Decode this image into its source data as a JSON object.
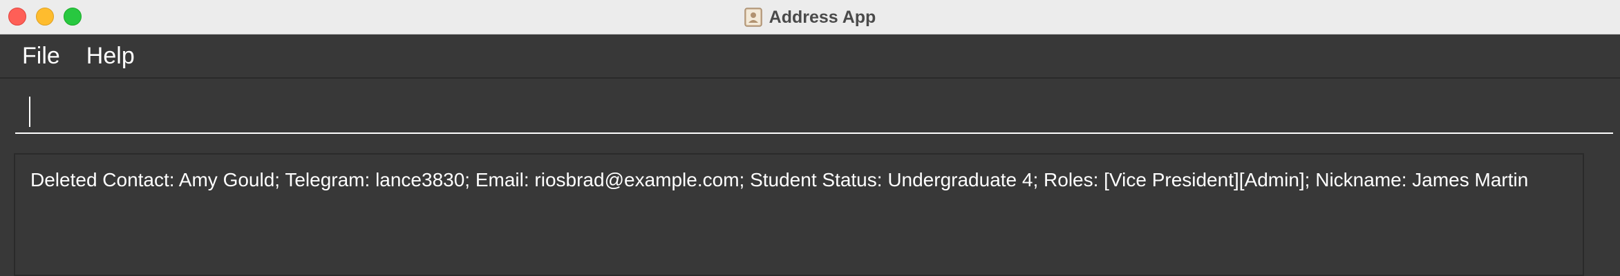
{
  "window": {
    "title": "Address App",
    "app_icon": "address-book-icon"
  },
  "traffic_lights": {
    "close_color": "#fe5f57",
    "minimize_color": "#febc2e",
    "zoom_color": "#28c840"
  },
  "menu": {
    "items": [
      {
        "label": "File"
      },
      {
        "label": "Help"
      }
    ]
  },
  "command": {
    "value": "",
    "placeholder": ""
  },
  "result": {
    "text": "Deleted Contact: Amy Gould; Telegram: lance3830; Email: riosbrad@example.com; Student Status: Undergraduate 4; Roles: [Vice President][Admin]; Nickname: James Martin"
  },
  "colors": {
    "background": "#383838",
    "titlebar": "#ececec",
    "text": "#ffffff",
    "title_text": "#4a4a4a"
  }
}
